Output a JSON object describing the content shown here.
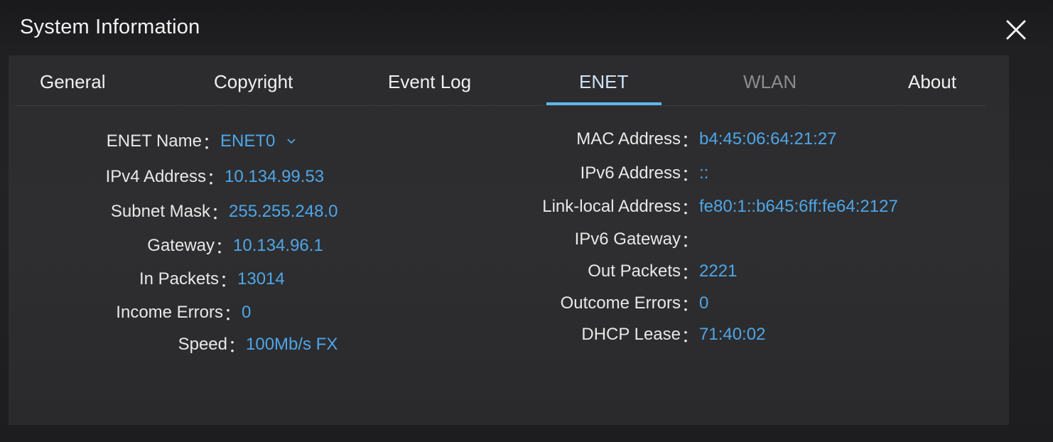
{
  "window": {
    "title": "System Information",
    "close_icon": "close-icon"
  },
  "tabs": [
    {
      "label": "General",
      "active": false
    },
    {
      "label": "Copyright",
      "active": false
    },
    {
      "label": "Event Log",
      "active": false
    },
    {
      "label": "ENET",
      "active": true
    },
    {
      "label": "WLAN",
      "active": false,
      "disabled": true
    },
    {
      "label": "About",
      "active": false
    }
  ],
  "colors": {
    "value": "#4ea6e8",
    "tab_underline": "#5fb6ec"
  },
  "left": {
    "enet_name": {
      "label": "ENET Name",
      "value": "ENET0"
    },
    "ipv4": {
      "label": "IPv4 Address",
      "value": "10.134.99.53"
    },
    "subnet": {
      "label": "Subnet Mask",
      "value": "255.255.248.0"
    },
    "gateway": {
      "label": "Gateway",
      "value": "10.134.96.1"
    },
    "in_packets": {
      "label": "In Packets",
      "value": "13014"
    },
    "income_errors": {
      "label": "Income Errors",
      "value": "0"
    },
    "speed": {
      "label": "Speed",
      "value": "100Mb/s FX"
    }
  },
  "right": {
    "mac": {
      "label": "MAC Address",
      "value": "b4:45:06:64:21:27"
    },
    "ipv6": {
      "label": "IPv6 Address",
      "value": "::"
    },
    "link_local": {
      "label": "Link-local Address",
      "value": "fe80:1::b645:6ff:fe64:2127"
    },
    "ipv6_gateway": {
      "label": "IPv6 Gateway",
      "value": ""
    },
    "out_packets": {
      "label": "Out Packets",
      "value": "2221"
    },
    "outcome_errors": {
      "label": "Outcome Errors",
      "value": "0"
    },
    "dhcp_lease": {
      "label": "DHCP Lease",
      "value": "71:40:02"
    }
  },
  "separator": "："
}
